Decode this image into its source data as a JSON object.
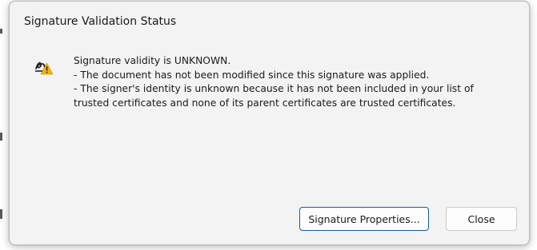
{
  "dialog": {
    "title": "Signature Validation Status",
    "icon": "signature-warning-icon",
    "message_lines": [
      "Signature validity is UNKNOWN.",
      "- The document has not been modified since this signature was applied.",
      "- The signer's identity is unknown because it has not been included in your list of",
      "trusted certificates and none of its parent certificates are trusted certificates."
    ],
    "buttons": {
      "properties_label": "Signature Properties...",
      "close_label": "Close"
    }
  },
  "colors": {
    "dialog_background": "#f3f3f3",
    "warning_yellow": "#f5b400",
    "primary_button_border": "#0f5ba8"
  }
}
